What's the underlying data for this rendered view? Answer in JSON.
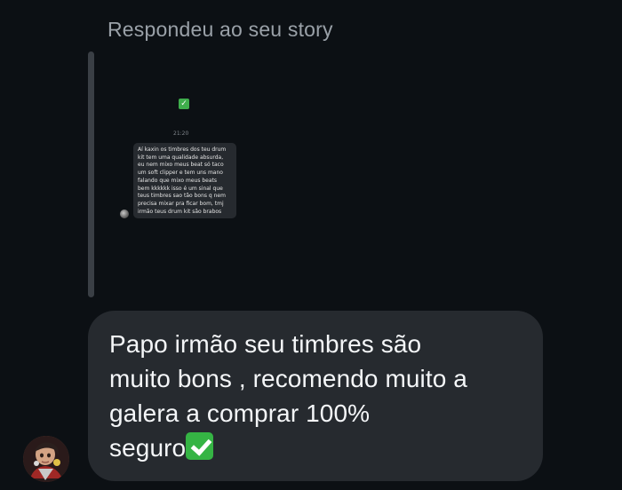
{
  "header": {
    "replied_to_story": "Respondeu ao seu story"
  },
  "story_preview": {
    "check_emoji": "✅",
    "time": "21:20",
    "message_lines": [
      "Aí kaxin os timbres dos teu drum",
      "kit tem uma qualidade absurda,",
      "eu nem mixo meus beat só taco",
      "um soft clipper e tem uns mano",
      "falando que mixo meus beats",
      "bem kkkkkk isso é um sinal que",
      "teus timbres sao tão bons q nem",
      "precisa mixar pra ficar bom, tmj",
      "irmão teus drum kit são brabos"
    ]
  },
  "reply": {
    "lines": [
      "Papo irmão seu timbres são",
      "muito bons , recomendo muito a",
      "galera a comprar  100%",
      "seguro"
    ],
    "emoji": "✅"
  },
  "icons": {
    "check_icon": "check-mark-button-icon",
    "avatar": "profile-avatar"
  }
}
